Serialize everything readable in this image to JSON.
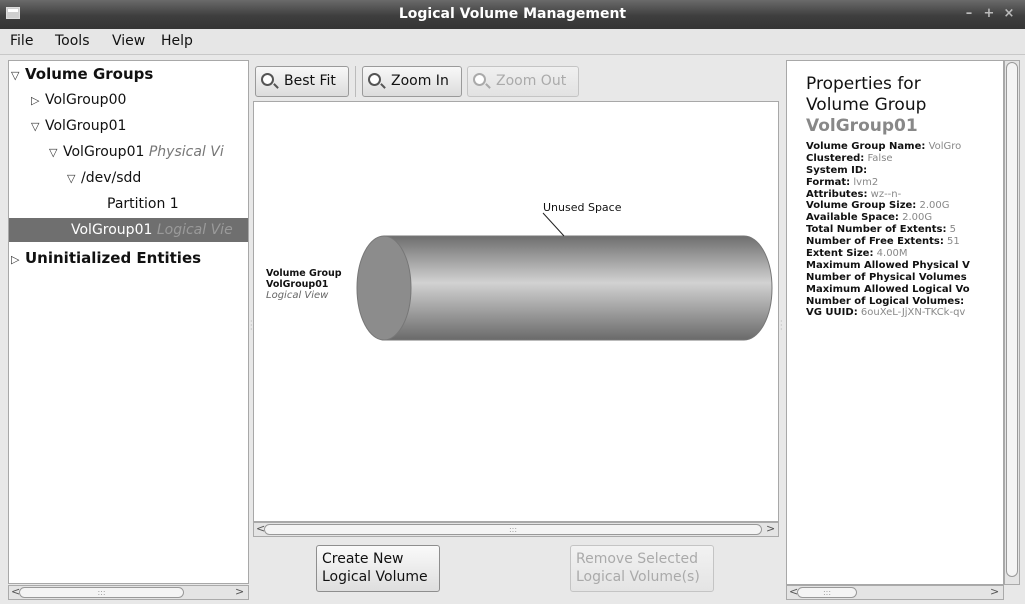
{
  "window": {
    "title": "Logical Volume Management"
  },
  "menu": [
    "File",
    "Tools",
    "View",
    "Help"
  ],
  "tree": {
    "volume_groups": "Volume Groups",
    "volgroup00": "VolGroup00",
    "volgroup01": "VolGroup01",
    "pv_name": "VolGroup01",
    "pv_view": "Physical Vi",
    "dev": "/dev/sdd",
    "partition": "Partition 1",
    "lv_name": "VolGroup01",
    "lv_view": "Logical Vie",
    "uninit": "Uninitialized Entities"
  },
  "toolbar": {
    "best_fit": "Best Fit",
    "zoom_in": "Zoom In",
    "zoom_out": "Zoom Out"
  },
  "canvas": {
    "vg_title": "Volume Group",
    "vg_name": "VolGroup01",
    "vg_view": "Logical View",
    "unused_label": "Unused Space"
  },
  "buttons": {
    "create": [
      "Create New",
      "Logical Volume"
    ],
    "remove": [
      "Remove Selected",
      "Logical Volume(s)"
    ]
  },
  "properties": {
    "heading": [
      "Properties for",
      "Volume Group"
    ],
    "name": "VolGroup01",
    "items": [
      {
        "label": "Volume Group Name:",
        "value": "VolGro"
      },
      {
        "label": "Clustered:",
        "value": "False"
      },
      {
        "label": "System ID:",
        "value": ""
      },
      {
        "label": "Format:",
        "value": "lvm2"
      },
      {
        "label": "Attributes:",
        "value": "wz--n-"
      },
      {
        "label": "Volume Group Size:",
        "value": "2.00G"
      },
      {
        "label": "Available Space:",
        "value": "2.00G"
      },
      {
        "label": "Total Number of Extents:",
        "value": "5"
      },
      {
        "label": "Number of Free Extents:",
        "value": "51"
      },
      {
        "label": "Extent Size:",
        "value": "4.00M"
      },
      {
        "label": "Maximum Allowed Physical V",
        "value": ""
      },
      {
        "label": "Number of Physical Volumes",
        "value": ""
      },
      {
        "label": "Maximum Allowed Logical Vo",
        "value": ""
      },
      {
        "label": "Number of Logical Volumes:",
        "value": ""
      },
      {
        "label": "VG UUID:",
        "value": "6ouXeL-JjXN-TKCk-qv"
      }
    ]
  },
  "colors": {
    "cylinder": "#8c8c8c",
    "selected_row": "#6f6f6f",
    "titlebar": "#3e3e3e"
  }
}
